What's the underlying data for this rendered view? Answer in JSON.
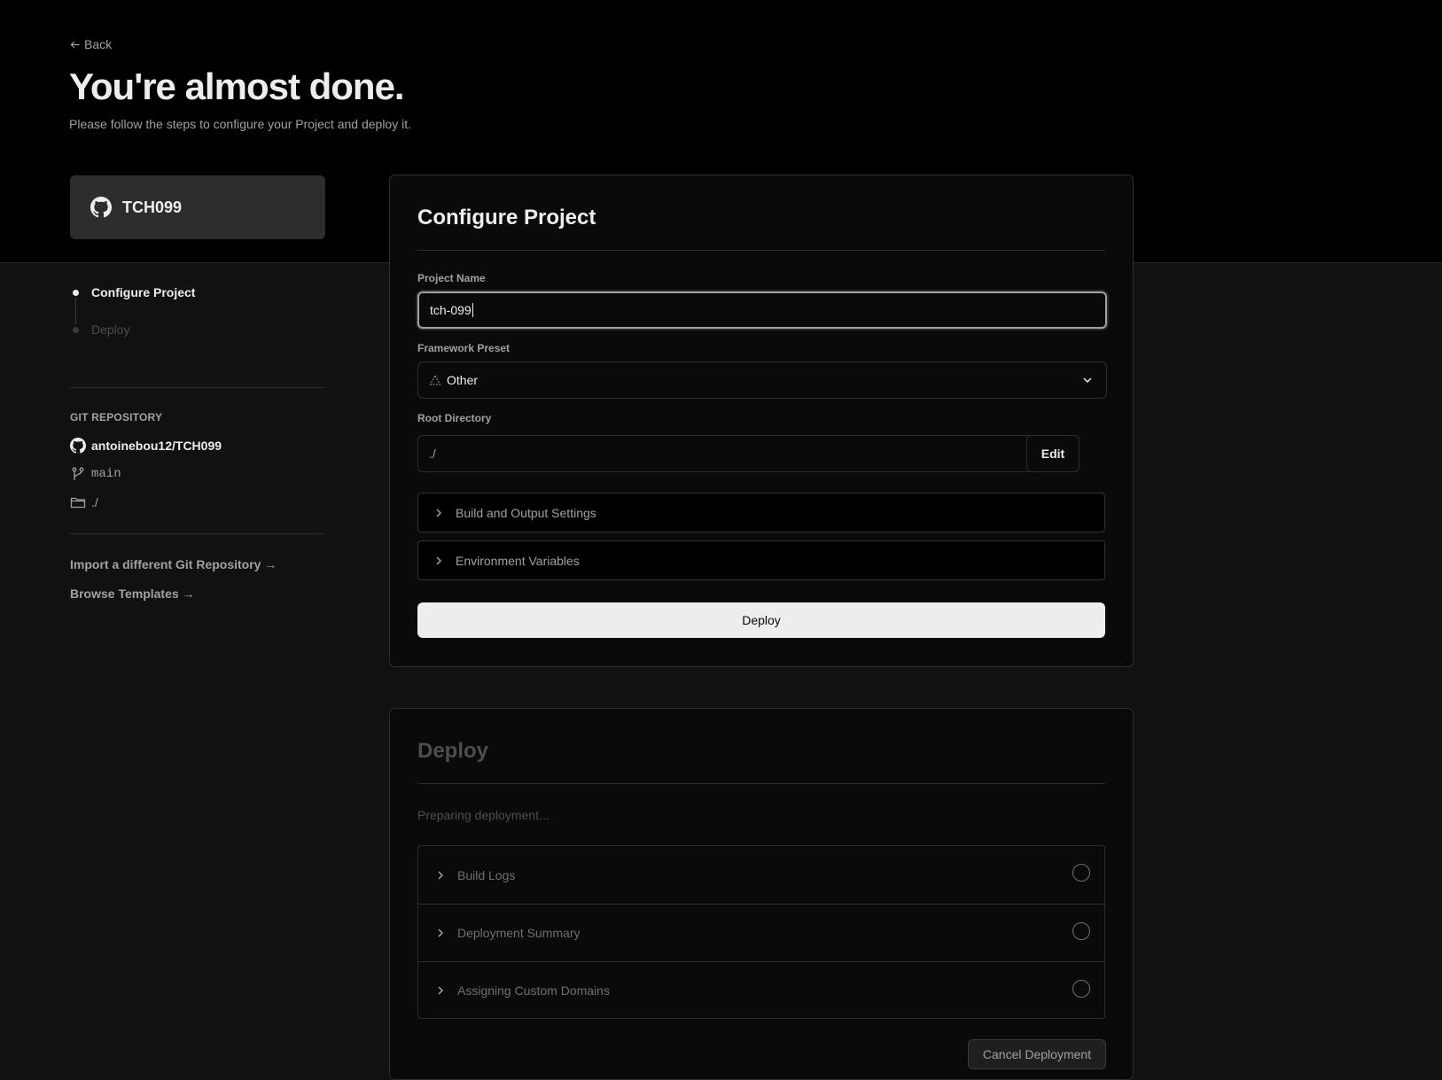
{
  "header": {
    "back_label": "Back",
    "title": "You're almost done.",
    "subtitle": "Please follow the steps to configure your Project and deploy it."
  },
  "repo_card": {
    "name": "TCH099",
    "icon": "github-icon"
  },
  "steps": [
    {
      "label": "Configure Project",
      "state": "active"
    },
    {
      "label": "Deploy",
      "state": "inactive"
    }
  ],
  "git": {
    "section_label": "GIT REPOSITORY",
    "repo": "antoinebou12/TCH099",
    "branch": "main",
    "directory": "./"
  },
  "links": {
    "import_label": "Import a different Git Repository →",
    "templates_label": "Browse Templates →"
  },
  "configure": {
    "title": "Configure Project",
    "project_name_label": "Project Name",
    "project_name_value": "tch-099",
    "framework_label": "Framework Preset",
    "framework_value": "Other",
    "root_dir_label": "Root Directory",
    "root_dir_value": "./",
    "edit_label": "Edit",
    "build_settings_label": "Build and Output Settings",
    "env_vars_label": "Environment Variables",
    "deploy_label": "Deploy"
  },
  "deploy": {
    "title": "Deploy",
    "status_text": "Preparing deployment...",
    "items": [
      {
        "label": "Build Logs"
      },
      {
        "label": "Deployment Summary"
      },
      {
        "label": "Assigning Custom Domains"
      }
    ],
    "cancel_label": "Cancel Deployment"
  },
  "colors": {
    "hero_bg": "#000000",
    "page_bg": "#111111",
    "card_bg": "#0a0a0a",
    "primary_button": "#ededed"
  }
}
